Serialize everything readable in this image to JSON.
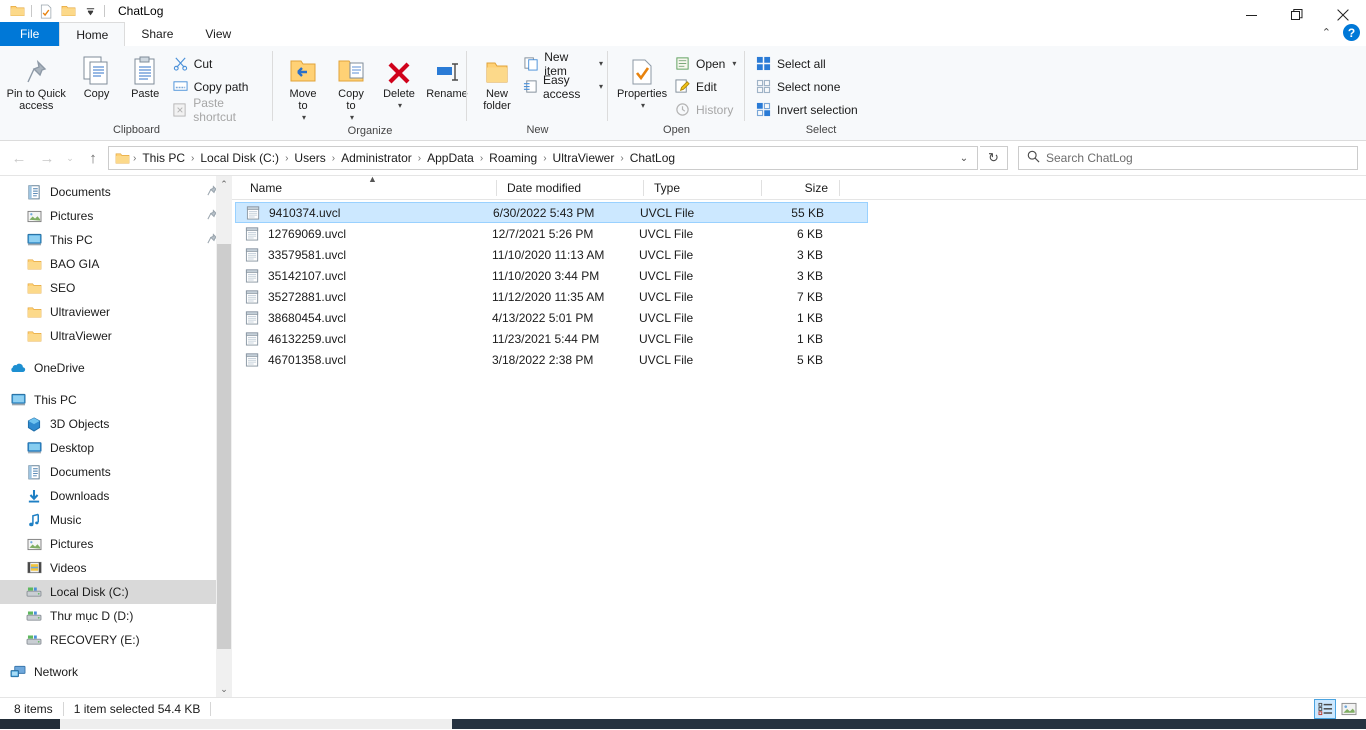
{
  "window": {
    "title": "ChatLog",
    "quick_access": [
      "folder-icon",
      "properties-icon",
      "new-folder-icon",
      "customize-dropdown"
    ],
    "minimize_label": "—",
    "maximize_label": "❐",
    "close_label": "✕",
    "collapse_ribbon_label": "⌃",
    "help_label": "?"
  },
  "tabs": [
    {
      "label": "File",
      "active": false,
      "kind": "file"
    },
    {
      "label": "Home",
      "active": true,
      "kind": "normal"
    },
    {
      "label": "Share",
      "active": false,
      "kind": "normal"
    },
    {
      "label": "View",
      "active": false,
      "kind": "normal"
    }
  ],
  "ribbon": {
    "groups": [
      {
        "label": "Clipboard",
        "big": [
          {
            "label": "Pin to Quick access",
            "icon": "pin-icon",
            "disabled": false
          },
          {
            "label": "Copy",
            "icon": "copy-icon",
            "disabled": false
          },
          {
            "label": "Paste",
            "icon": "paste-icon",
            "disabled": false
          }
        ],
        "small": [
          {
            "label": "Cut",
            "icon": "scissors-icon",
            "disabled": false
          },
          {
            "label": "Copy path",
            "icon": "copy-path-icon",
            "disabled": false
          },
          {
            "label": "Paste shortcut",
            "icon": "paste-shortcut-icon",
            "disabled": true
          }
        ]
      },
      {
        "label": "Organize",
        "big": [
          {
            "label": "Move to",
            "icon": "move-to-icon",
            "dropdown": true
          },
          {
            "label": "Copy to",
            "icon": "copy-to-icon",
            "dropdown": true
          },
          {
            "label": "Delete",
            "icon": "delete-icon",
            "dropdown": true
          },
          {
            "label": "Rename",
            "icon": "rename-icon",
            "dropdown": false
          }
        ],
        "small": []
      },
      {
        "label": "New",
        "big": [
          {
            "label": "New folder",
            "icon": "new-folder-icon",
            "dropdown": false
          }
        ],
        "small": [
          {
            "label": "New item",
            "icon": "new-item-icon",
            "dropdown": true
          },
          {
            "label": "Easy access",
            "icon": "easy-access-icon",
            "dropdown": true
          }
        ]
      },
      {
        "label": "Open",
        "big": [
          {
            "label": "Properties",
            "icon": "properties-icon",
            "dropdown": true
          }
        ],
        "small": [
          {
            "label": "Open",
            "icon": "open-icon",
            "dropdown": true,
            "disabled": false
          },
          {
            "label": "Edit",
            "icon": "edit-icon",
            "disabled": false
          },
          {
            "label": "History",
            "icon": "history-icon",
            "disabled": true
          }
        ]
      },
      {
        "label": "Select",
        "big": [],
        "small": [
          {
            "label": "Select all",
            "icon": "select-all-icon",
            "disabled": false
          },
          {
            "label": "Select none",
            "icon": "select-none-icon",
            "disabled": false
          },
          {
            "label": "Invert selection",
            "icon": "invert-selection-icon",
            "disabled": false
          }
        ]
      }
    ]
  },
  "address": {
    "back_label": "←",
    "forward_label": "→",
    "recent_label": "⌄",
    "up_label": "↑",
    "breadcrumbs": [
      "This PC",
      "Local Disk (C:)",
      "Users",
      "Administrator",
      "AppData",
      "Roaming",
      "UltraViewer",
      "ChatLog"
    ],
    "separator": "›",
    "dropdown_label": "⌄",
    "refresh_label": "↻",
    "search_placeholder": "Search ChatLog",
    "search_value": ""
  },
  "nav_pane": {
    "items": [
      {
        "label": "Documents",
        "icon": "documents-icon",
        "indent": 1,
        "pinned": true,
        "selected": false
      },
      {
        "label": "Pictures",
        "icon": "pictures-icon",
        "indent": 1,
        "pinned": true,
        "selected": false
      },
      {
        "label": "This PC",
        "icon": "this-pc-icon",
        "indent": 1,
        "pinned": true,
        "selected": false
      },
      {
        "label": "BAO GIA",
        "icon": "folder-icon",
        "indent": 1,
        "pinned": false,
        "selected": false
      },
      {
        "label": "SEO",
        "icon": "folder-icon",
        "indent": 1,
        "pinned": false,
        "selected": false
      },
      {
        "label": "Ultraviewer",
        "icon": "folder-icon",
        "indent": 1,
        "pinned": false,
        "selected": false
      },
      {
        "label": "UltraViewer",
        "icon": "folder-icon",
        "indent": 1,
        "pinned": false,
        "selected": false
      },
      {
        "label": "",
        "icon": "gap",
        "indent": 0,
        "pinned": false,
        "selected": false
      },
      {
        "label": "OneDrive",
        "icon": "onedrive-icon",
        "indent": 0,
        "pinned": false,
        "selected": false
      },
      {
        "label": "",
        "icon": "gap",
        "indent": 0,
        "pinned": false,
        "selected": false
      },
      {
        "label": "This PC",
        "icon": "this-pc-icon",
        "indent": 0,
        "pinned": false,
        "selected": false
      },
      {
        "label": "3D Objects",
        "icon": "3d-objects-icon",
        "indent": 1,
        "pinned": false,
        "selected": false
      },
      {
        "label": "Desktop",
        "icon": "desktop-icon",
        "indent": 1,
        "pinned": false,
        "selected": false
      },
      {
        "label": "Documents",
        "icon": "documents-icon",
        "indent": 1,
        "pinned": false,
        "selected": false
      },
      {
        "label": "Downloads",
        "icon": "downloads-icon",
        "indent": 1,
        "pinned": false,
        "selected": false
      },
      {
        "label": "Music",
        "icon": "music-icon",
        "indent": 1,
        "pinned": false,
        "selected": false
      },
      {
        "label": "Pictures",
        "icon": "pictures-icon",
        "indent": 1,
        "pinned": false,
        "selected": false
      },
      {
        "label": "Videos",
        "icon": "videos-icon",
        "indent": 1,
        "pinned": false,
        "selected": false
      },
      {
        "label": "Local Disk (C:)",
        "icon": "drive-icon",
        "indent": 1,
        "pinned": false,
        "selected": true
      },
      {
        "label": "Thư mục D (D:)",
        "icon": "drive-icon",
        "indent": 1,
        "pinned": false,
        "selected": false
      },
      {
        "label": "RECOVERY (E:)",
        "icon": "drive-icon",
        "indent": 1,
        "pinned": false,
        "selected": false
      },
      {
        "label": "",
        "icon": "gap",
        "indent": 0,
        "pinned": false,
        "selected": false
      },
      {
        "label": "Network",
        "icon": "network-icon",
        "indent": 0,
        "pinned": false,
        "selected": false
      }
    ],
    "scroll_up_label": "⌃",
    "scroll_down_label": "⌄"
  },
  "file_list": {
    "columns": [
      "Name",
      "Date modified",
      "Type",
      "Size"
    ],
    "sort_column": "Name",
    "sort_direction": "ascending",
    "rows": [
      {
        "name": "9410374.uvcl",
        "date": "6/30/2022 5:43 PM",
        "type": "UVCL File",
        "size": "55 KB",
        "selected": true
      },
      {
        "name": "12769069.uvcl",
        "date": "12/7/2021 5:26 PM",
        "type": "UVCL File",
        "size": "6 KB",
        "selected": false
      },
      {
        "name": "33579581.uvcl",
        "date": "11/10/2020 11:13 AM",
        "type": "UVCL File",
        "size": "3 KB",
        "selected": false
      },
      {
        "name": "35142107.uvcl",
        "date": "11/10/2020 3:44 PM",
        "type": "UVCL File",
        "size": "3 KB",
        "selected": false
      },
      {
        "name": "35272881.uvcl",
        "date": "11/12/2020 11:35 AM",
        "type": "UVCL File",
        "size": "7 KB",
        "selected": false
      },
      {
        "name": "38680454.uvcl",
        "date": "4/13/2022 5:01 PM",
        "type": "UVCL File",
        "size": "1 KB",
        "selected": false
      },
      {
        "name": "46132259.uvcl",
        "date": "11/23/2021 5:44 PM",
        "type": "UVCL File",
        "size": "1 KB",
        "selected": false
      },
      {
        "name": "46701358.uvcl",
        "date": "3/18/2022 2:38 PM",
        "type": "UVCL File",
        "size": "5 KB",
        "selected": false
      }
    ]
  },
  "status_bar": {
    "item_count": "8 items",
    "selection": "1 item selected  54.4 KB",
    "details_view_label": "details-view",
    "large_icons_view_label": "large-icons-view",
    "active_view": "details"
  },
  "colors": {
    "accent": "#0078d7",
    "selection_fill": "#cce8ff",
    "selection_border": "#99d1ff",
    "folder_yellow": "#ffd175",
    "ribbon_bg": "#f7f9fb",
    "taskbar": "#1f2a36"
  }
}
